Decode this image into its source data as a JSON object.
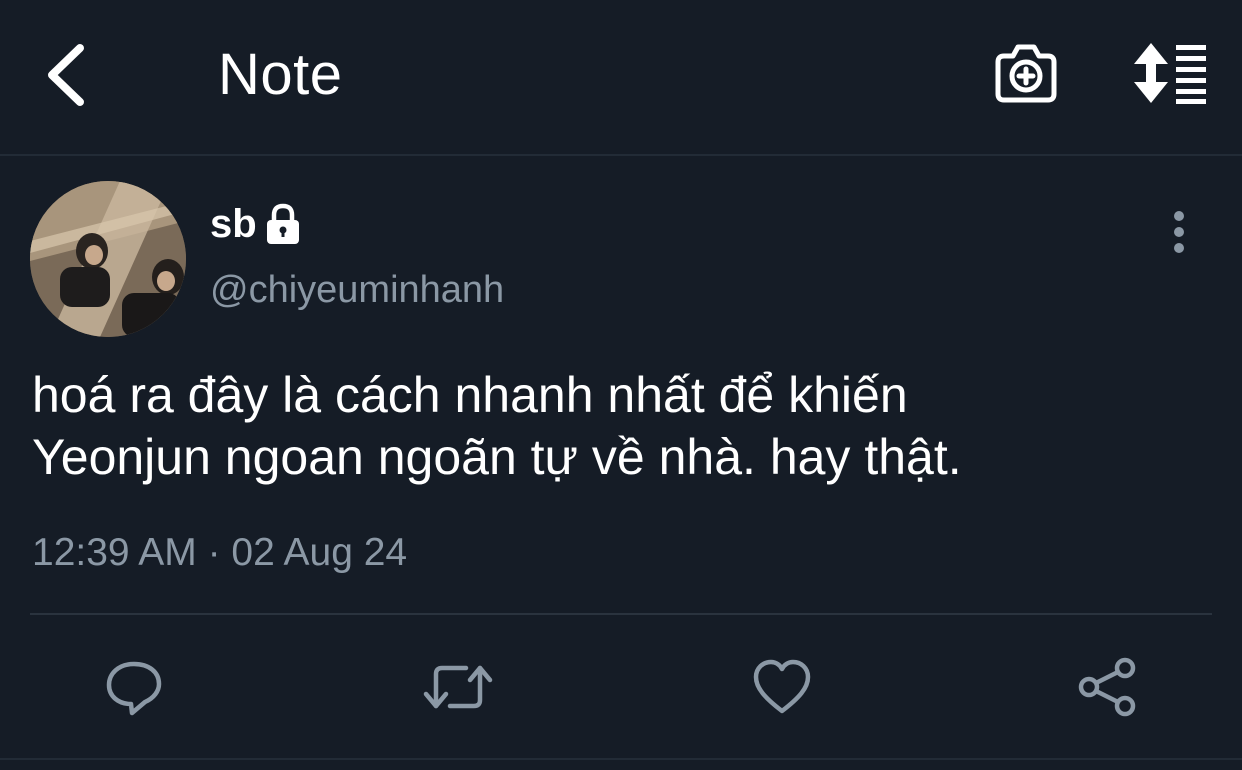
{
  "header": {
    "title": "Note",
    "icons": {
      "back": "back-chevron-icon",
      "camera": "camera-plus-icon",
      "sort": "sort-list-icon"
    }
  },
  "post": {
    "author": {
      "display_name": "sb",
      "handle": "@chiyeuminhanh",
      "protected": true
    },
    "text_lines": [
      "hoá ra đây là cách nhanh nhất để khiến",
      "Yeonjun ngoan ngoãn tự về nhà. hay thật."
    ],
    "timestamp": "12:39 AM · 02 Aug 24",
    "actions": [
      "reply-icon",
      "retweet-icon",
      "like-icon",
      "share-icon"
    ]
  },
  "colors": {
    "background": "#151c26",
    "text_primary": "#ffffff",
    "text_secondary": "#8b98a5",
    "divider": "#2a333e"
  }
}
